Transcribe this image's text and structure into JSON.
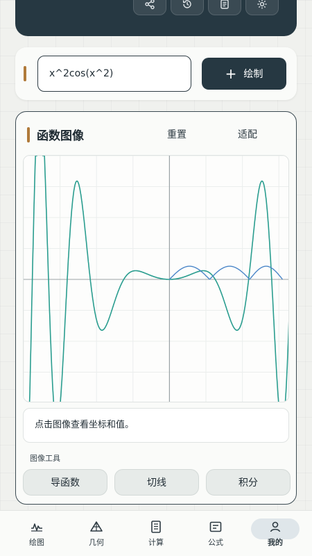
{
  "header": {
    "tools": [
      "share-icon",
      "history-icon",
      "document-icon",
      "settings-icon"
    ]
  },
  "input": {
    "value": "x^2cos(x^2)",
    "plot_label": "绘制",
    "plot_icon": "plus-icon"
  },
  "graph": {
    "title": "函数图像",
    "reset_label": "重置",
    "fit_label": "适配",
    "info_text": "点击图像查看坐标和值。",
    "tools_label": "图像工具",
    "tools": [
      "导函数",
      "切线",
      "积分"
    ]
  },
  "chart_data": {
    "type": "line",
    "title": "",
    "xlabel": "",
    "ylabel": "",
    "xlim": [
      -4.0,
      3.3
    ],
    "ylim": [
      -8.0,
      8.0
    ],
    "grid": true,
    "series": [
      {
        "function": "x^2cos(x^2)",
        "color": "#2a9d8f"
      },
      {
        "color": "#4a86c8"
      }
    ]
  },
  "nav": {
    "items": [
      {
        "label": "绘图",
        "icon": "wave-icon"
      },
      {
        "label": "几何",
        "icon": "triangle-icon"
      },
      {
        "label": "计算",
        "icon": "list-icon"
      },
      {
        "label": "公式",
        "icon": "formula-icon"
      },
      {
        "label": "我的",
        "icon": "user-icon"
      }
    ],
    "active": 4
  },
  "colors": {
    "dark": "#263842",
    "accent": "#b07a3a",
    "curve": "#2a9d8f",
    "derivative": "#4a86c8"
  }
}
